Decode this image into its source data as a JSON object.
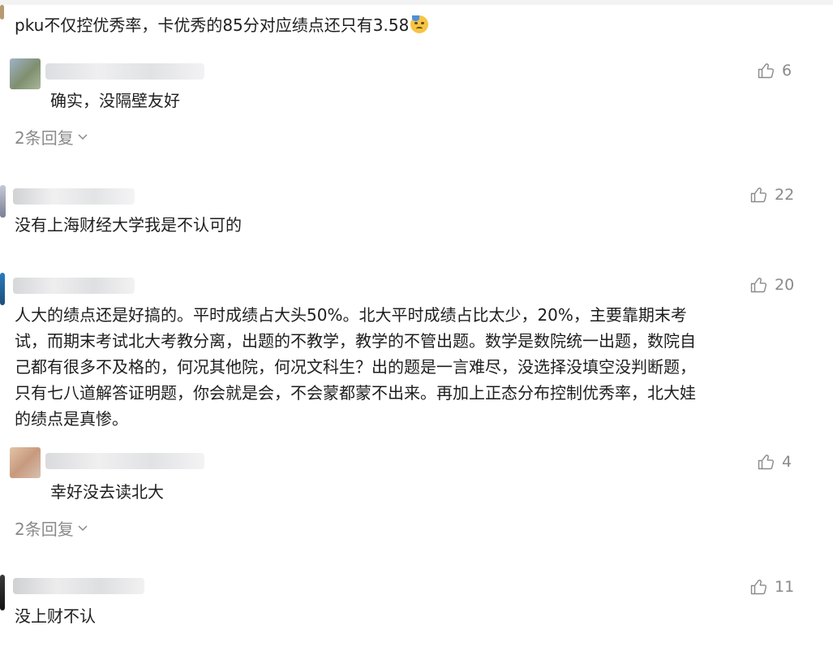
{
  "comments": [
    {
      "text": "pku不仅控优秀率，卡优秀的85分对应绩点还只有3.58"
    },
    {
      "likes": "6",
      "text": "确实，没隔壁友好",
      "replies": "2条回复"
    },
    {
      "likes": "22",
      "text": "没有上海财经大学我是不认可的"
    },
    {
      "likes": "20",
      "lines": [
        "人大的绩点还是好搞的。平时成绩占大头50%。北大平时成绩占比太少，20%，主要靠期末考",
        "试，而期末考试北大考教分离，出题的不教学，教学的不管出题。数学是数院统一出题，数院自",
        "己都有很多不及格的，何况其他院，何况文科生？出的题是一言难尽，没选择没填空没判断题，",
        "只有七八道解答证明题，你会就是会，不会蒙都蒙不出来。再加上正态分布控制优秀率，北大娃",
        "的绩点是真惨。"
      ]
    },
    {
      "likes": "4",
      "text": "幸好没去读北大",
      "replies": "2条回复"
    },
    {
      "likes": "11",
      "text": "没上财不认"
    }
  ],
  "icons": {
    "like": "thumbs-up-icon",
    "chevron": "chevron-down-icon",
    "emoji": "sweat-face-emoji"
  }
}
